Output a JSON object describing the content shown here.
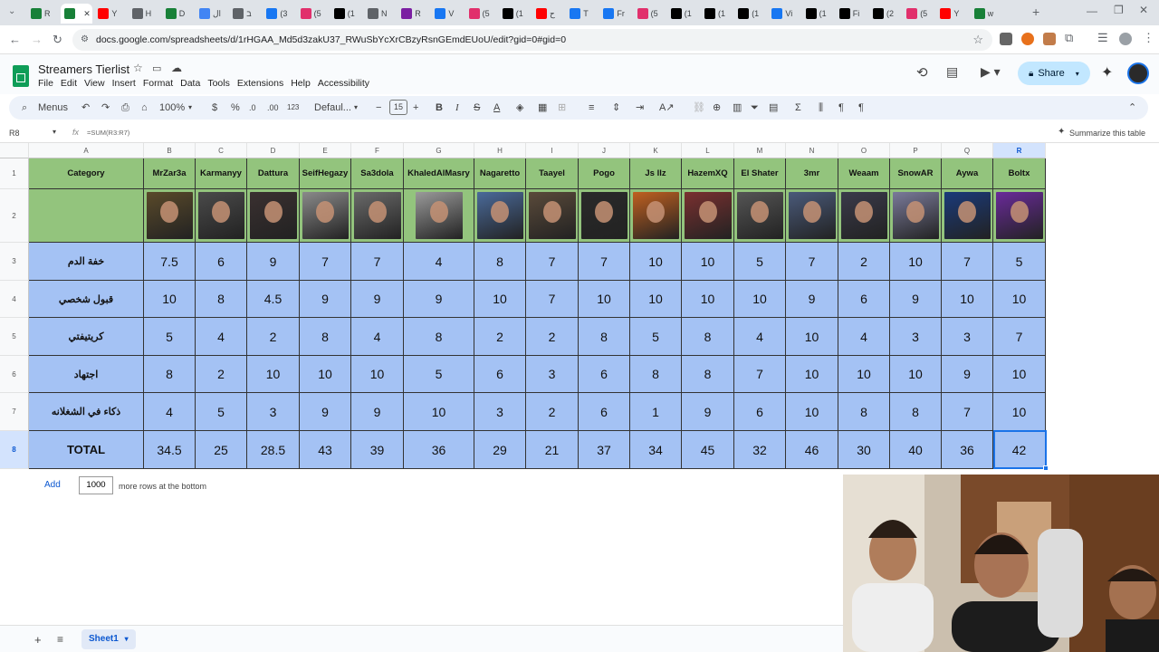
{
  "browser": {
    "tabs": [
      {
        "label": "R",
        "color": "#188038"
      },
      {
        "label": "",
        "color": "#188038",
        "active": true
      },
      {
        "label": "Y",
        "color": "#ff0000"
      },
      {
        "label": "H",
        "color": "#5f6368"
      },
      {
        "label": "D",
        "color": "#188038"
      },
      {
        "label": "ال",
        "color": "#4285f4"
      },
      {
        "label": "ב",
        "color": "#5f6368"
      },
      {
        "label": "(3",
        "color": "#1877f2"
      },
      {
        "label": "(5",
        "color": "#e1306c"
      },
      {
        "label": "(1",
        "color": "#000000"
      },
      {
        "label": "N",
        "color": "#5f6368"
      },
      {
        "label": "R",
        "color": "#7b1fa2"
      },
      {
        "label": "V",
        "color": "#1877f2"
      },
      {
        "label": "(5",
        "color": "#e1306c"
      },
      {
        "label": "(1",
        "color": "#000000"
      },
      {
        "label": "ح",
        "color": "#ff0000"
      },
      {
        "label": "T",
        "color": "#1877f2"
      },
      {
        "label": "Fr",
        "color": "#1877f2"
      },
      {
        "label": "(5",
        "color": "#e1306c"
      },
      {
        "label": "(1",
        "color": "#000000"
      },
      {
        "label": "(1",
        "color": "#000000"
      },
      {
        "label": "(1",
        "color": "#000000"
      },
      {
        "label": "Vi",
        "color": "#1877f2"
      },
      {
        "label": "(1",
        "color": "#000000"
      },
      {
        "label": "Fi",
        "color": "#000000"
      },
      {
        "label": "(2",
        "color": "#000000"
      },
      {
        "label": "(5",
        "color": "#e1306c"
      },
      {
        "label": "Y",
        "color": "#ff0000"
      },
      {
        "label": "w",
        "color": "#188038"
      }
    ],
    "url": "docs.google.com/spreadsheets/d/1rHGAA_Md5d3zakU37_RWuSbYcXrCBzyRsnGEmdEUoU/edit?gid=0#gid=0"
  },
  "doc": {
    "title": "Streamers Tierlist",
    "menus": [
      "File",
      "Edit",
      "View",
      "Insert",
      "Format",
      "Data",
      "Tools",
      "Extensions",
      "Help",
      "Accessibility"
    ],
    "share_label": "Share"
  },
  "toolbar": {
    "menus_label": "Menus",
    "zoom": "100%",
    "currency": "$",
    "percent": "%",
    "dec_less": ".0",
    "dec_more": ".00",
    "number_format": "123",
    "font": "Defaul...",
    "font_size": "15",
    "minus": "−",
    "plus": "+"
  },
  "formula": {
    "cell_ref": "R8",
    "fx": "fx",
    "formula_text": "=SUM(R3:R7)",
    "summarize_label": "Summarize this table"
  },
  "grid": {
    "columns": [
      "A",
      "B",
      "C",
      "D",
      "E",
      "F",
      "G",
      "H",
      "I",
      "J",
      "K",
      "L",
      "M",
      "N",
      "O",
      "P",
      "Q",
      "R"
    ],
    "rows": [
      "1",
      "2",
      "3",
      "4",
      "5",
      "6",
      "7",
      "8"
    ],
    "header_label": "Category",
    "streamers": [
      "MrZar3a",
      "Karmanyy",
      "Dattura",
      "SeifHegazy",
      "Sa3dola",
      "KhaledAlMasry",
      "Nagaretto",
      "Taayel",
      "Pogo",
      "Js llz",
      "HazemXQ",
      "El Shater",
      "3mr",
      "Weaam",
      "SnowAR",
      "Aywa",
      "Boltx"
    ],
    "thumb_colors": [
      "#5a4a2a",
      "#4a4a4a",
      "#3a3030",
      "#8a8a8a",
      "#6a6a6a",
      "#9a9a9a",
      "#4a6a9a",
      "#5a4a3a",
      "#2a2a2a",
      "#c06020",
      "#7a3030",
      "#555555",
      "#4a5a7a",
      "#3a3a4a",
      "#7a7a9a",
      "#1a3a7a",
      "#6a2a9a"
    ],
    "categories": [
      "خفة الدم",
      "قبول شخصي",
      "كريتيفتي",
      "اجتهاد",
      "ذكاء في الشغلانه"
    ],
    "values": [
      [
        "7.5",
        "6",
        "9",
        "7",
        "7",
        "4",
        "8",
        "7",
        "7",
        "10",
        "10",
        "5",
        "7",
        "2",
        "10",
        "7",
        "5"
      ],
      [
        "10",
        "8",
        "4.5",
        "9",
        "9",
        "9",
        "10",
        "7",
        "10",
        "10",
        "10",
        "10",
        "9",
        "6",
        "9",
        "10",
        "10"
      ],
      [
        "5",
        "4",
        "2",
        "8",
        "4",
        "8",
        "2",
        "2",
        "8",
        "5",
        "8",
        "4",
        "10",
        "4",
        "3",
        "3",
        "7"
      ],
      [
        "8",
        "2",
        "10",
        "10",
        "10",
        "5",
        "6",
        "3",
        "6",
        "8",
        "8",
        "7",
        "10",
        "10",
        "10",
        "9",
        "10"
      ],
      [
        "4",
        "5",
        "3",
        "9",
        "9",
        "10",
        "3",
        "2",
        "6",
        "1",
        "9",
        "6",
        "10",
        "8",
        "8",
        "7",
        "10"
      ]
    ],
    "total_label": "TOTAL",
    "totals": [
      "34.5",
      "25",
      "28.5",
      "43",
      "39",
      "36",
      "29",
      "21",
      "37",
      "34",
      "45",
      "32",
      "46",
      "30",
      "40",
      "36",
      "42"
    ]
  },
  "footer": {
    "add_label": "Add",
    "rows_value": "1000",
    "rows_suffix": "more rows at the bottom",
    "sheet_name": "Sheet1"
  },
  "colors": {
    "header_green": "#93c47d",
    "cell_blue": "#a4c2f4",
    "selection": "#1a73e8",
    "sheets_green": "#0f9d58"
  }
}
